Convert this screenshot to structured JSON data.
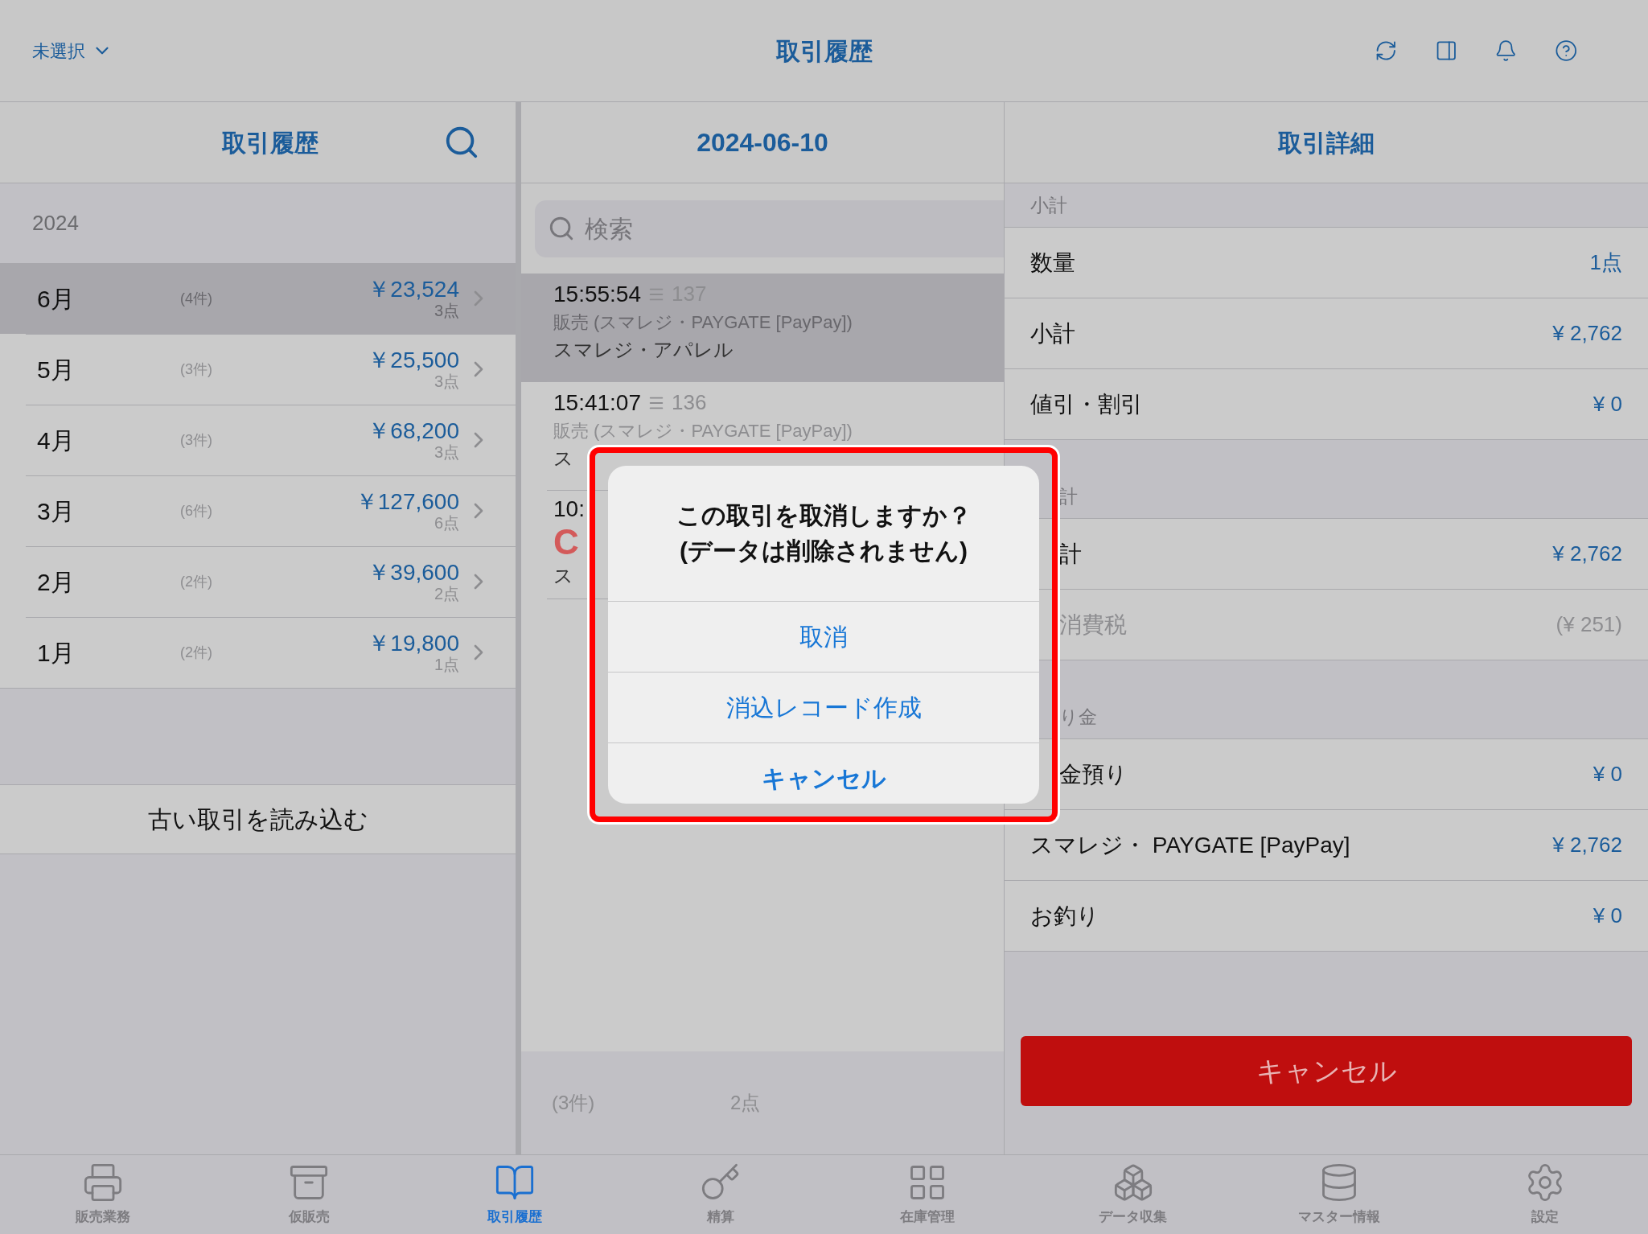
{
  "top_bar": {
    "store_selector": "未選択",
    "title": "取引履歴"
  },
  "left": {
    "title": "取引履歴",
    "year": "2024",
    "months": [
      {
        "label": "6月",
        "count": "(4件)",
        "amount": "￥23,524",
        "points": "3点",
        "selected": true
      },
      {
        "label": "5月",
        "count": "(3件)",
        "amount": "￥25,500",
        "points": "3点",
        "selected": false
      },
      {
        "label": "4月",
        "count": "(3件)",
        "amount": "￥68,200",
        "points": "3点",
        "selected": false
      },
      {
        "label": "3月",
        "count": "(6件)",
        "amount": "￥127,600",
        "points": "6点",
        "selected": false
      },
      {
        "label": "2月",
        "count": "(2件)",
        "amount": "￥39,600",
        "points": "2点",
        "selected": false
      },
      {
        "label": "1月",
        "count": "(2件)",
        "amount": "￥19,800",
        "points": "1点",
        "selected": false
      }
    ],
    "load_more": "古い取引を読み込む"
  },
  "middle": {
    "title": "2024-06-10",
    "search_placeholder": "検索",
    "transactions": [
      {
        "time": "15:55:54",
        "number": "137",
        "description": "販売 (スマレジ・PAYGATE [PayPay])",
        "store": "スマレジ・アパレル",
        "selected": true
      },
      {
        "time": "15:41:07",
        "number": "136",
        "description": "販売 (スマレジ・PAYGATE [PayPay])",
        "store": "ス",
        "selected": false
      },
      {
        "time": "10:",
        "stamp": "C",
        "store": "ス",
        "selected": false
      }
    ],
    "footer": {
      "count": "(3件)",
      "points": "2点"
    }
  },
  "right": {
    "title": "取引詳細",
    "sections": [
      {
        "header": "小計",
        "rows": [
          {
            "label": "数量",
            "value": "1点",
            "muted": false
          },
          {
            "label": "小計",
            "value": "¥ 2,762",
            "muted": false
          },
          {
            "label": "値引・割引",
            "value": "¥ 0",
            "muted": false
          }
        ]
      },
      {
        "header": "計",
        "rows": [
          {
            "label": "計",
            "value": "¥ 2,762",
            "muted": false
          },
          {
            "label": "消費税",
            "value": "(¥ 251)",
            "muted": true
          }
        ]
      },
      {
        "header": "り金",
        "rows": [
          {
            "label": "金預り",
            "value": "¥ 0",
            "muted": false
          },
          {
            "label": "スマレジ・ PAYGATE [PayPay]",
            "value": "¥ 2,762",
            "muted": false
          },
          {
            "label": "お釣り",
            "value": "¥ 0",
            "muted": false
          }
        ]
      }
    ],
    "cancel_button": "キャンセル"
  },
  "dialog": {
    "message_lines": [
      "この取引を取消しますか？",
      "(データは削除されません)"
    ],
    "actions": [
      {
        "label": "取消",
        "kind": "default"
      },
      {
        "label": "消込レコード作成",
        "kind": "default"
      },
      {
        "label": "キャンセル",
        "kind": "cancel"
      }
    ]
  },
  "tab_bar": [
    {
      "label": "販売業務",
      "selected": false
    },
    {
      "label": "仮販売",
      "selected": false
    },
    {
      "label": "取引履歴",
      "selected": true
    },
    {
      "label": "精算",
      "selected": false
    },
    {
      "label": "在庫管理",
      "selected": false
    },
    {
      "label": "データ収集",
      "selected": false
    },
    {
      "label": "マスター情報",
      "selected": false
    },
    {
      "label": "設定",
      "selected": false
    }
  ]
}
